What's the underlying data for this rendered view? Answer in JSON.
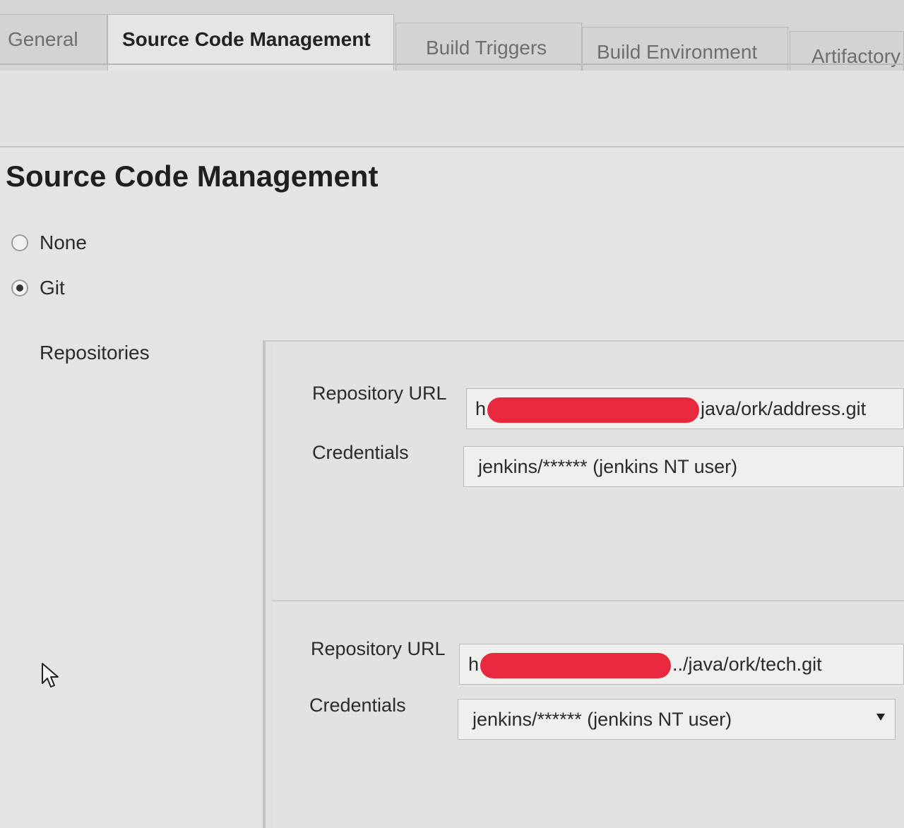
{
  "tabs": [
    {
      "label": "General",
      "active": false
    },
    {
      "label": "Source Code Management",
      "active": true
    },
    {
      "label": "Build Triggers",
      "active": false
    },
    {
      "label": "Build Environment",
      "active": false
    },
    {
      "label": "Artifactory",
      "active": false
    }
  ],
  "section": {
    "title": "Source Code Management"
  },
  "scm_options": [
    {
      "label": "None",
      "selected": false
    },
    {
      "label": "Git",
      "selected": true
    }
  ],
  "repositories": {
    "label": "Repositories",
    "items": [
      {
        "url_label": "Repository URL",
        "url_prefix": "h",
        "url_suffix": "java/ork/address.git",
        "credentials_label": "Credentials",
        "credentials_value": "jenkins/****** (jenkins NT user)"
      },
      {
        "url_label": "Repository URL",
        "url_prefix": "h",
        "url_suffix": "../java/ork/tech.git",
        "credentials_label": "Credentials",
        "credentials_value": "jenkins/****** (jenkins NT user)"
      }
    ]
  },
  "colors": {
    "redaction": "#e8283c",
    "background": "#e3e5e2"
  },
  "icons": {
    "radio": "radio-button",
    "select": "chevron-down-icon",
    "cursor": "mouse-pointer-icon"
  }
}
